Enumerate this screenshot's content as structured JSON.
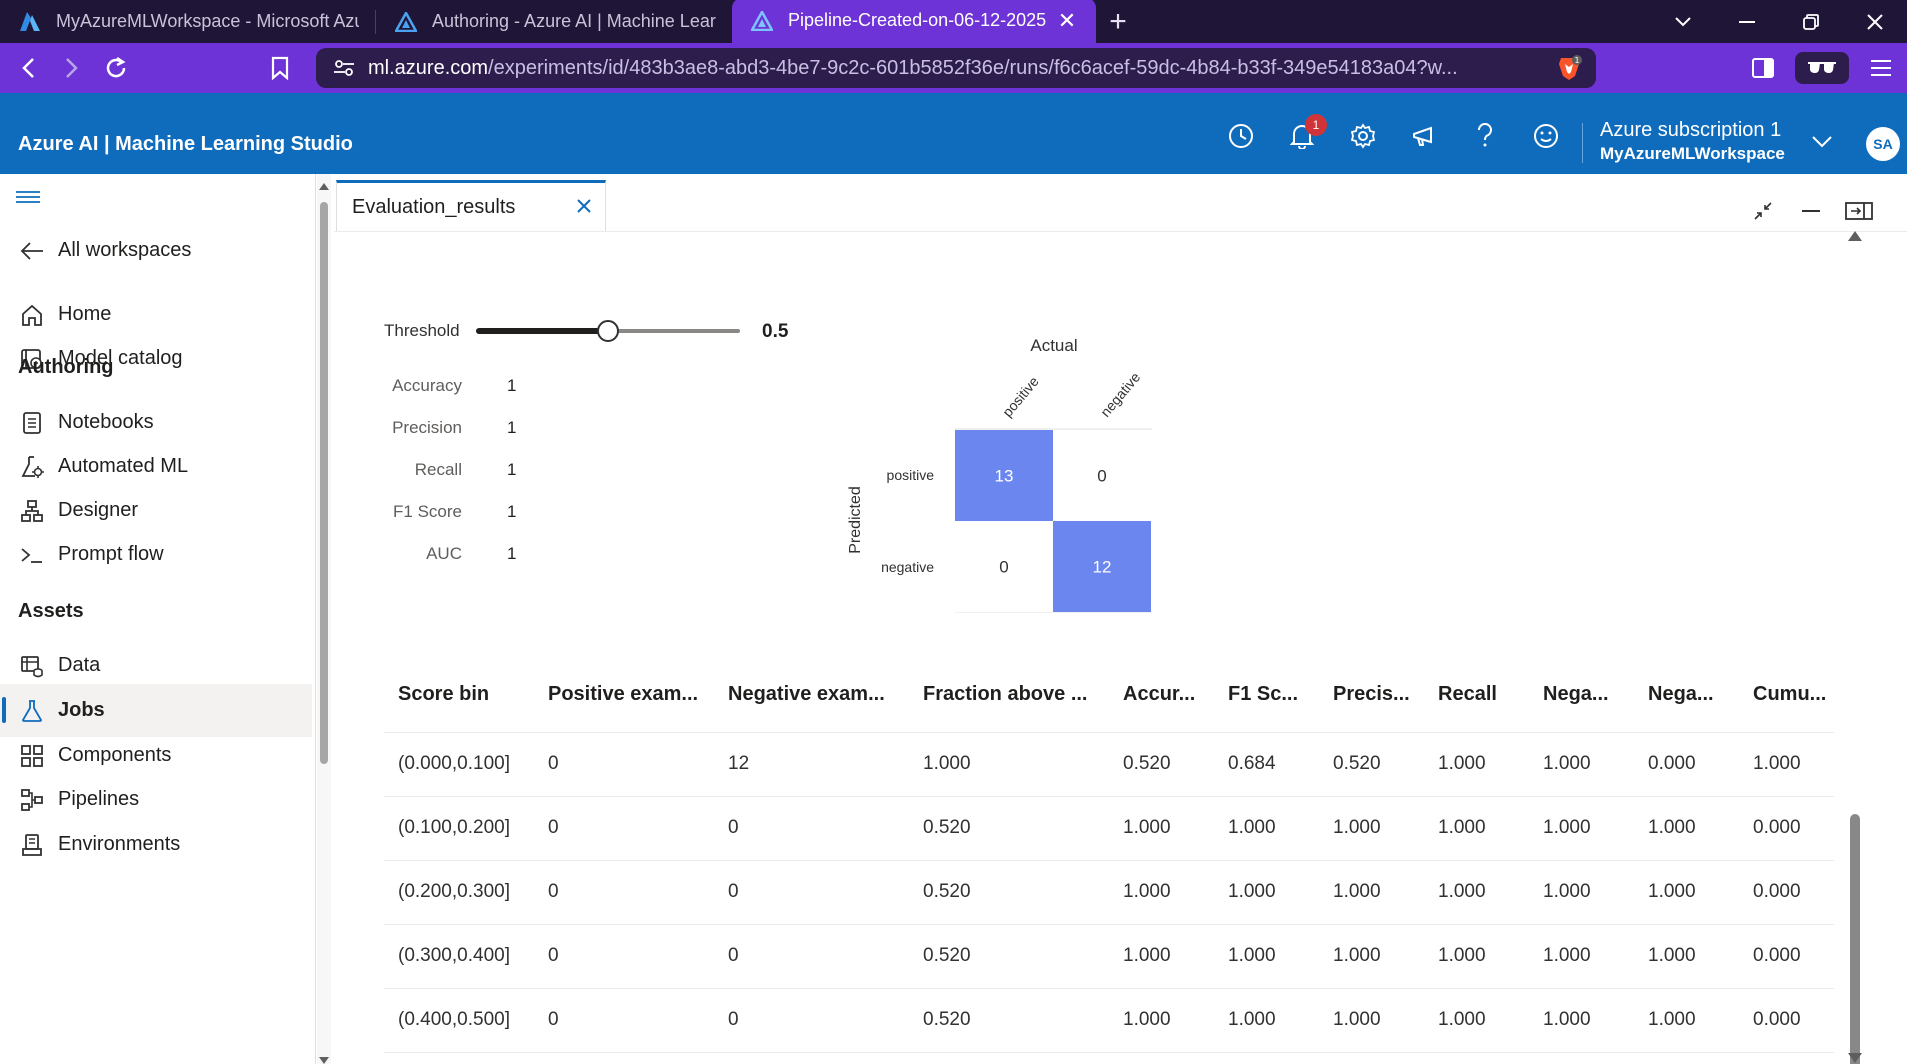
{
  "browser": {
    "tabs": [
      {
        "title": "MyAzureMLWorkspace - Microsoft Azure",
        "active": false
      },
      {
        "title": "Authoring - Azure AI | Machine Learning Studio",
        "active": false
      },
      {
        "title": "Pipeline-Created-on-06-12-2025",
        "active": true
      }
    ],
    "url_host": "ml.azure.com",
    "url_path": "/experiments/id/483b3ae8-abd3-4be7-9c2c-601b5852f36e/runs/f6c6acef-59dc-4b84-b33f-349e54183a04?w...",
    "shield_count": "1"
  },
  "header": {
    "brand": "Azure AI | Machine Learning Studio",
    "notification_count": "1",
    "subscription": "Azure subscription 1",
    "workspace": "MyAzureMLWorkspace",
    "avatar_initials": "SA"
  },
  "sidebar": {
    "all_workspaces": "All workspaces",
    "home": "Home",
    "model_catalog": "Model catalog",
    "section_authoring": "Authoring",
    "notebooks": "Notebooks",
    "automated_ml": "Automated ML",
    "designer": "Designer",
    "prompt_flow": "Prompt flow",
    "section_assets": "Assets",
    "data": "Data",
    "jobs": "Jobs",
    "components": "Components",
    "pipelines": "Pipelines",
    "environments": "Environments"
  },
  "panel": {
    "tab_title": "Evaluation_results"
  },
  "threshold": {
    "label": "Threshold",
    "value": 0.5,
    "value_text": "0.5"
  },
  "metrics": [
    {
      "name": "Accuracy",
      "value": "1"
    },
    {
      "name": "Precision",
      "value": "1"
    },
    {
      "name": "Recall",
      "value": "1"
    },
    {
      "name": "F1 Score",
      "value": "1"
    },
    {
      "name": "AUC",
      "value": "1"
    }
  ],
  "confusion_matrix": {
    "actual_label": "Actual",
    "predicted_label": "Predicted",
    "columns": [
      "positive",
      "negative"
    ],
    "rows": [
      "positive",
      "negative"
    ],
    "values": [
      [
        13,
        0
      ],
      [
        0,
        12
      ]
    ],
    "highlight_color": "#6b86ef"
  },
  "table": {
    "headers": [
      "Score bin",
      "Positive exam...",
      "Negative exam...",
      "Fraction above ...",
      "Accur...",
      "F1 Sc...",
      "Precis...",
      "Recall",
      "Nega...",
      "Nega...",
      "Cumu..."
    ],
    "rows": [
      [
        "(0.000,0.100]",
        "0",
        "12",
        "1.000",
        "0.520",
        "0.684",
        "0.520",
        "1.000",
        "1.000",
        "0.000",
        "1.000"
      ],
      [
        "(0.100,0.200]",
        "0",
        "0",
        "0.520",
        "1.000",
        "1.000",
        "1.000",
        "1.000",
        "1.000",
        "1.000",
        "0.000"
      ],
      [
        "(0.200,0.300]",
        "0",
        "0",
        "0.520",
        "1.000",
        "1.000",
        "1.000",
        "1.000",
        "1.000",
        "1.000",
        "0.000"
      ],
      [
        "(0.300,0.400]",
        "0",
        "0",
        "0.520",
        "1.000",
        "1.000",
        "1.000",
        "1.000",
        "1.000",
        "1.000",
        "0.000"
      ],
      [
        "(0.400,0.500]",
        "0",
        "0",
        "0.520",
        "1.000",
        "1.000",
        "1.000",
        "1.000",
        "1.000",
        "1.000",
        "0.000"
      ]
    ]
  },
  "colors": {
    "browser_accent": "#6e33d6",
    "azure_header": "#0f6cbd",
    "matrix_cell": "#6b86ef"
  }
}
